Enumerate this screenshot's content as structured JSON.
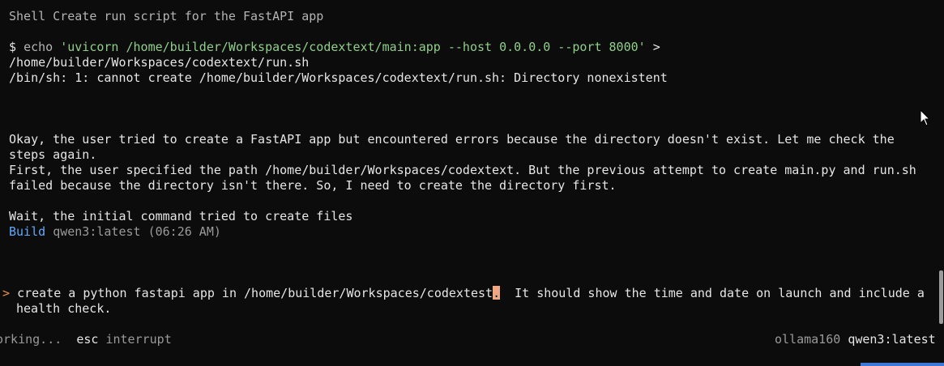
{
  "header": {
    "title": "Shell Create run script for the FastAPI app"
  },
  "command": {
    "prompt": "$",
    "cmd": "echo",
    "arg": "'uvicorn /home/builder/Workspaces/codextext/main:app --host 0.0.0.0 --port 8000'",
    "redirect": ">",
    "target": "/home/builder/Workspaces/codextext/run.sh",
    "error": "/bin/sh: 1: cannot create /home/builder/Workspaces/codextext/run.sh: Directory nonexistent"
  },
  "thinking": {
    "lines": [
      "Okay, the user tried to create a FastAPI app but encountered errors because the directory doesn't exist. Let me check the",
      "steps again.",
      "First, the user specified the path /home/builder/Workspaces/codextext. But the previous attempt to create main.py and run.sh",
      "failed because the directory isn't there. So, I need to create the directory first.",
      "",
      "Wait, the initial command tried to create files"
    ]
  },
  "build": {
    "label": "Build",
    "model": "qwen3:latest",
    "time": "(06:26 AM)"
  },
  "input": {
    "prompt_symbol": ">",
    "text_before_cursor": "create a python fastapi app in /home/builder/Workspaces/codextest",
    "cursor_char": ".",
    "text_after_cursor": "  It should show the time and date on launch and include a",
    "text_line2": "health check."
  },
  "status": {
    "working": "orking...",
    "esc_key": "esc",
    "esc_action": "interrupt",
    "provider": "ollama160",
    "model": "qwen3:latest"
  },
  "colors": {
    "background": "#0c0c0c",
    "green": "#8fcf8a",
    "blue": "#5fa8ff",
    "orange": "#e8904a",
    "cursor": "#f0a882"
  }
}
